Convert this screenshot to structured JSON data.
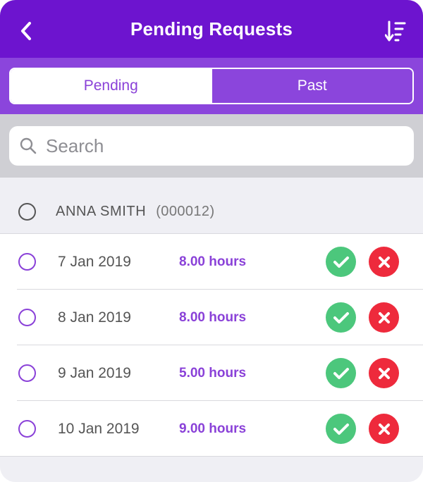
{
  "header": {
    "title": "Pending Requests",
    "back_icon": "chevron-left-icon",
    "sort_icon": "sort-descending-icon"
  },
  "tabs": [
    {
      "label": "Pending",
      "active": true
    },
    {
      "label": "Past",
      "active": false
    }
  ],
  "search": {
    "placeholder": "Search",
    "value": ""
  },
  "group": {
    "name": "ANNA SMITH",
    "id": "(000012)"
  },
  "requests": [
    {
      "date": "7 Jan 2019",
      "hours": "8.00 hours"
    },
    {
      "date": "8 Jan 2019",
      "hours": "8.00 hours"
    },
    {
      "date": "9 Jan 2019",
      "hours": "5.00 hours"
    },
    {
      "date": "10 Jan 2019",
      "hours": "9.00 hours"
    }
  ],
  "colors": {
    "nav": "#6d14cf",
    "accent": "#8a41d8",
    "approve": "#4cc77c",
    "reject": "#ee2a3c"
  }
}
